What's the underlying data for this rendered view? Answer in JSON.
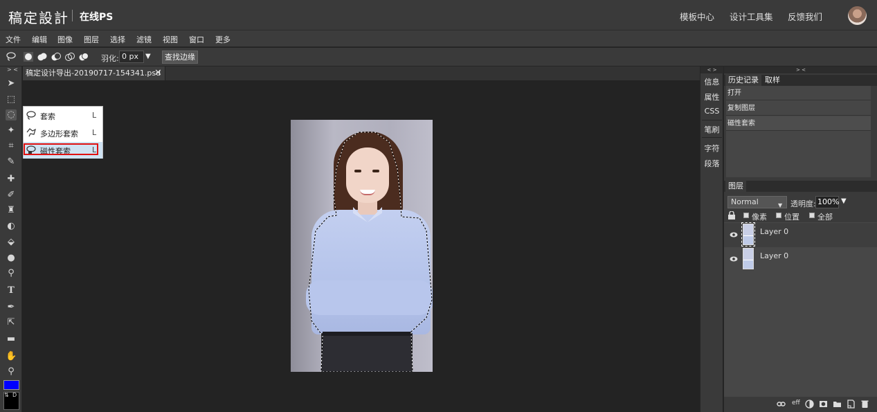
{
  "header": {
    "logo": "稿定設計",
    "sub_logo": "在线PS",
    "nav": [
      "模板中心",
      "设计工具集",
      "反馈我们"
    ]
  },
  "menu": [
    "文件",
    "编辑",
    "图像",
    "图层",
    "选择",
    "滤镜",
    "视图",
    "窗口",
    "更多"
  ],
  "options": {
    "feather_label": "羽化:",
    "feather_value": "0  px",
    "find_edge_button": "查找边缘"
  },
  "toolbar": {
    "collapse": "> <",
    "colors": {
      "foreground": "#0000ff",
      "background": "#000000"
    },
    "swap_label": "⇅",
    "default_label": "D"
  },
  "document": {
    "tab_title": "稿定设计导出-20190717-154341.psd",
    "close": "✕"
  },
  "lasso_flyout": {
    "items": [
      {
        "label": "套索",
        "key": "L"
      },
      {
        "label": "多边形套索",
        "key": "L"
      },
      {
        "label": "磁性套索",
        "key": "L"
      }
    ]
  },
  "mini_panel": {
    "collapse": "< >",
    "items": [
      "信息",
      "属性",
      "CSS",
      "笔刷",
      "字符",
      "段落"
    ]
  },
  "history_panel": {
    "collapse": "> <",
    "tabs": [
      "历史记录",
      "取样"
    ],
    "items": [
      "打开",
      "复制图层",
      "磁性套索"
    ]
  },
  "layers_panel": {
    "tab": "图层",
    "blend_mode": "Normal",
    "opacity_label": "透明度:",
    "opacity_value": "100%",
    "lock_options": [
      "像素",
      "位置",
      "全部"
    ],
    "layers": [
      {
        "name": "Layer 0"
      },
      {
        "name": "Layer 0"
      }
    ],
    "footer_eff": "eff"
  }
}
